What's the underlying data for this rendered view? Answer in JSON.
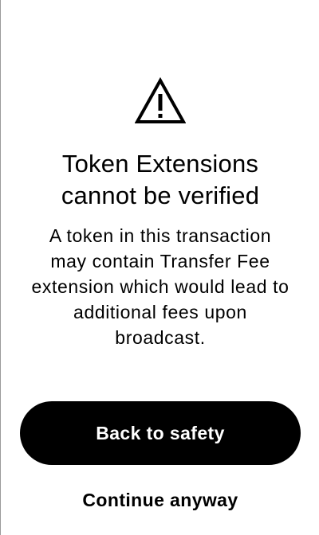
{
  "warning": {
    "icon": "warning-triangle-icon",
    "title_line1": "Token Extensions",
    "title_line2": "cannot be verified",
    "message_line1": "A token in this transaction",
    "message_line2": "may contain Transfer Fee",
    "message_line3": "extension which would lead to",
    "message_line4": "additional fees upon",
    "message_line5": "broadcast."
  },
  "actions": {
    "primary_label": "Back to safety",
    "secondary_label": "Continue anyway"
  },
  "colors": {
    "background": "#ffffff",
    "text": "#000000",
    "primary_button": "#000000",
    "primary_button_text": "#ffffff"
  }
}
